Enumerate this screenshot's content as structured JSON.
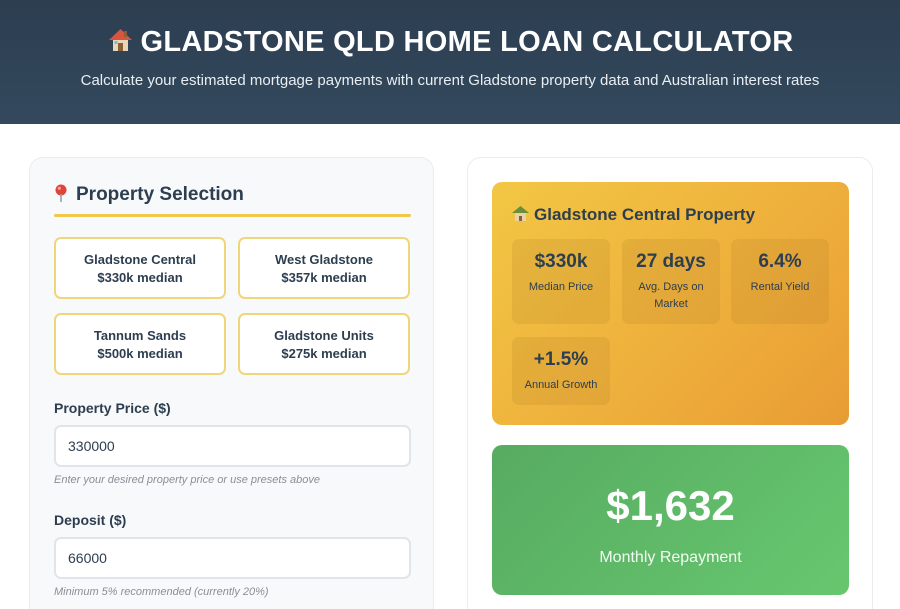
{
  "header": {
    "title": "GLADSTONE QLD HOME LOAN CALCULATOR",
    "subtitle": "Calculate your estimated mortgage payments with current Gladstone property data and Australian interest rates"
  },
  "selection": {
    "title": "Property Selection",
    "presets": [
      {
        "name": "Gladstone Central",
        "median": "$330k median"
      },
      {
        "name": "West Gladstone",
        "median": "$357k median"
      },
      {
        "name": "Tannum Sands",
        "median": "$500k median"
      },
      {
        "name": "Gladstone Units",
        "median": "$275k median"
      }
    ]
  },
  "form": {
    "price_label": "Property Price ($)",
    "price_value": "330000",
    "price_hint": "Enter your desired property price or use presets above",
    "deposit_label": "Deposit ($)",
    "deposit_value": "66000",
    "deposit_hint": "Minimum 5% recommended (currently 20%)"
  },
  "property_card": {
    "title": "Gladstone Central Property",
    "stats": [
      {
        "value": "$330k",
        "label": "Median Price"
      },
      {
        "value": "27 days",
        "label": "Avg. Days on Market"
      },
      {
        "value": "6.4%",
        "label": "Rental Yield"
      },
      {
        "value": "+1.5%",
        "label": "Annual Growth"
      }
    ]
  },
  "repayment": {
    "amount": "$1,632",
    "label": "Monthly Repayment"
  },
  "colors": {
    "header_bg": "#2c3e50",
    "accent_gold": "#f0c94a",
    "card_gold": "#eeae3b",
    "repay_green": "#5fb968"
  },
  "icons": {
    "header": "house-icon",
    "selection": "map-pin-icon",
    "property": "house-with-roof-icon"
  }
}
